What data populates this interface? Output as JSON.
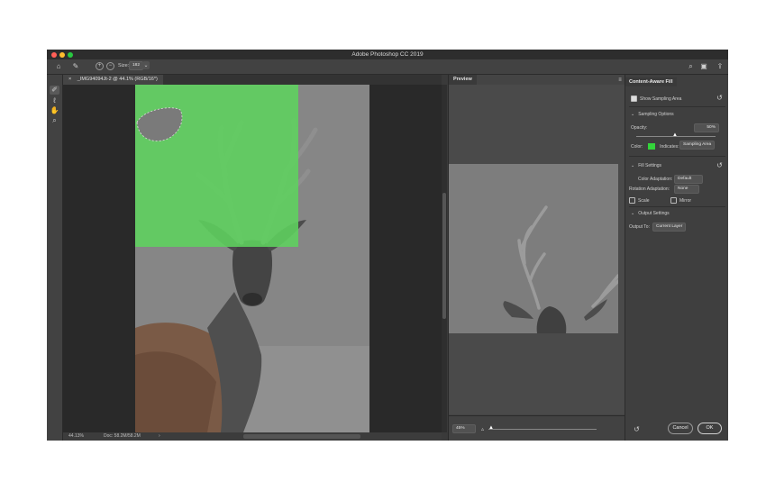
{
  "window": {
    "title": "Adobe Photoshop CC 2019"
  },
  "colors": {
    "selection_overlay": "#5ed35e",
    "indicates_swatch": "#33d43a",
    "traffic_red": "#ff5f57",
    "traffic_yellow": "#febc2e",
    "traffic_green": "#28c840"
  },
  "options_bar": {
    "size_label": "Size:",
    "size_value": "182"
  },
  "document": {
    "tab_close": "×",
    "tab_label": "_IMG94094Jt-2 @ 44.1% (RGB/16*)"
  },
  "status": {
    "zoom": "44.13%",
    "doc_info": "Doc: 58.2M/58.2M",
    "arrow": "›"
  },
  "preview": {
    "tab": "Preview",
    "zoom_value": "45%",
    "zoom_slider_level": 0.08
  },
  "caf": {
    "tab": "Content-Aware Fill",
    "show_sampling_area": "Show Sampling Area",
    "sampling_options": "Sampling Options",
    "opacity_label": "Opacity:",
    "opacity_value": "50%",
    "color_label": "Color:",
    "indicates_label": "Indicates:",
    "indicates_value": "Sampling Area",
    "fill_settings": "Fill Settings",
    "color_adaptation_label": "Color Adaptation:",
    "color_adaptation_value": "Default",
    "rotation_adaptation_label": "Rotation Adaptation:",
    "rotation_adaptation_value": "None",
    "scale_label": "Scale",
    "mirror_label": "Mirror",
    "output_settings": "Output Settings",
    "output_to_label": "Output To:",
    "output_to_value": "Current Layer",
    "cancel": "Cancel",
    "ok": "OK"
  }
}
